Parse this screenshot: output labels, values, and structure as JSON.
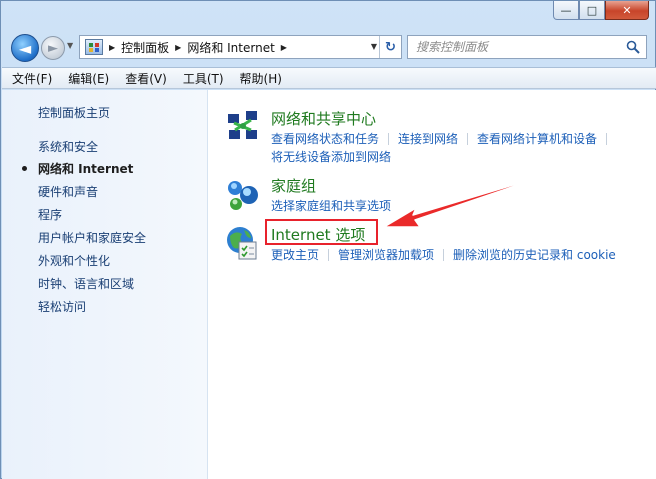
{
  "window": {
    "caption": {
      "minimize": "—",
      "maximize": "□",
      "close": "✕"
    }
  },
  "nav": {
    "back_glyph": "◄",
    "forward_glyph": "►",
    "breadcrumb": [
      "控制面板",
      "网络和 Internet"
    ],
    "search_placeholder": "搜索控制面板",
    "refresh_glyph": "↻"
  },
  "menu": [
    "文件(F)",
    "编辑(E)",
    "查看(V)",
    "工具(T)",
    "帮助(H)"
  ],
  "sidebar": {
    "items": [
      {
        "label": "控制面板主页",
        "current": false
      },
      {
        "label": "系统和安全",
        "current": false
      },
      {
        "label": "网络和 Internet",
        "current": true
      },
      {
        "label": "硬件和声音",
        "current": false
      },
      {
        "label": "程序",
        "current": false
      },
      {
        "label": "用户帐户和家庭安全",
        "current": false
      },
      {
        "label": "外观和个性化",
        "current": false
      },
      {
        "label": "时钟、语言和区域",
        "current": false
      },
      {
        "label": "轻松访问",
        "current": false
      }
    ]
  },
  "categories": [
    {
      "title": "网络和共享中心",
      "icon": "network-center-icon",
      "links": [
        "查看网络状态和任务",
        "连接到网络",
        "查看网络计算机和设备"
      ],
      "links2": "将无线设备添加到网络"
    },
    {
      "title": "家庭组",
      "icon": "homegroup-icon",
      "links": [
        "选择家庭组和共享选项"
      ]
    },
    {
      "title": "Internet 选项",
      "icon": "internet-options-icon",
      "links": [
        "更改主页",
        "管理浏览器加载项",
        "删除浏览的历史记录和 cookie"
      ]
    }
  ],
  "annotation": {
    "highlight_color": "#e8222c"
  }
}
